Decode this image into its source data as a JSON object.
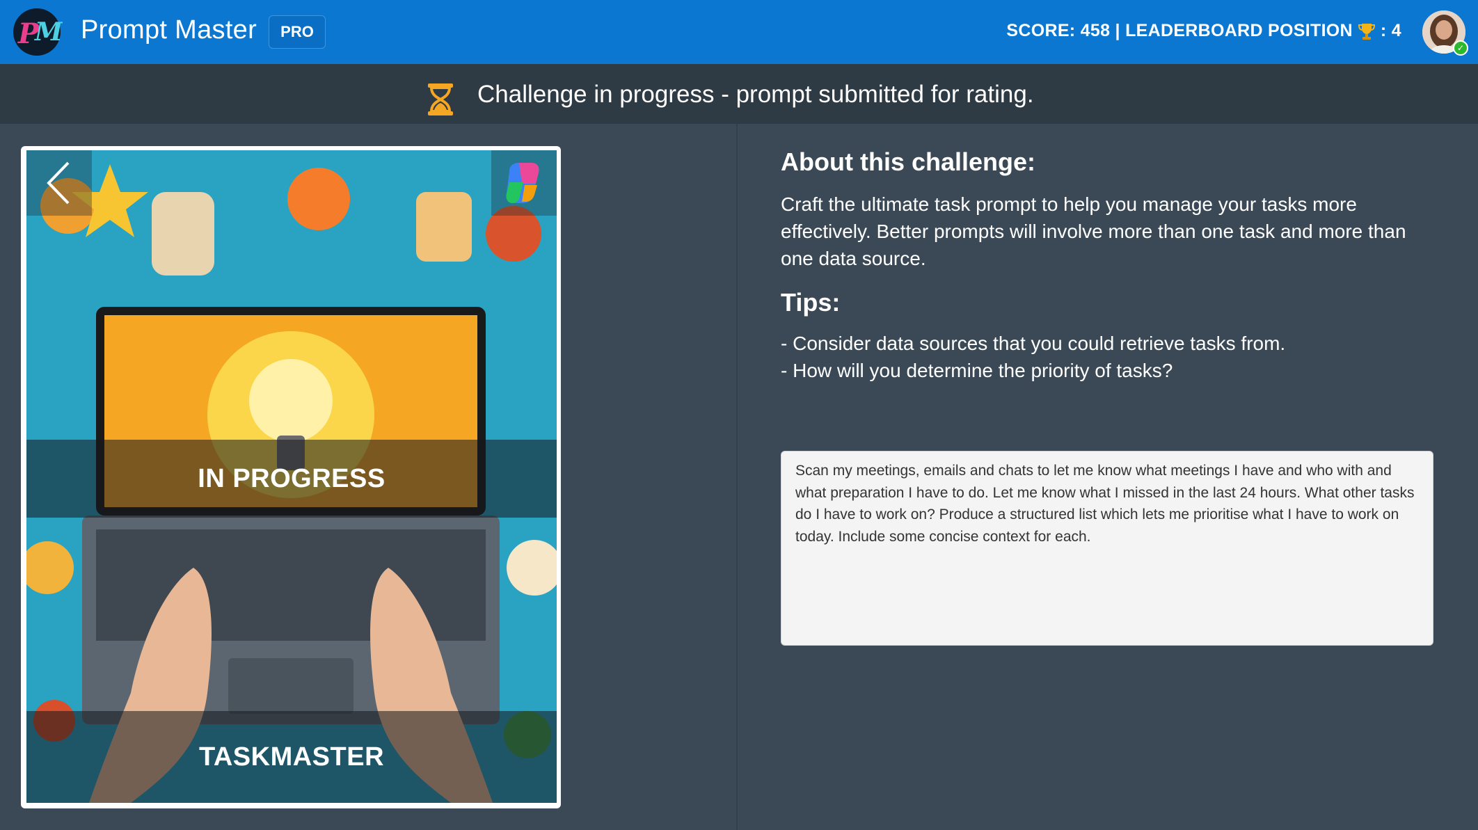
{
  "header": {
    "logo_text": "PM",
    "app_title": "Prompt Master",
    "badge": "PRO",
    "score_label": "SCORE: 458 | LEADERBOARD POSITION",
    "position_value": ": 4",
    "avatar_icon": "user-avatar",
    "trophy_icon": "trophy-icon"
  },
  "status": {
    "icon": "hourglass-icon",
    "text": "Challenge in progress - prompt submitted for rating."
  },
  "card": {
    "status_banner": "IN PROGRESS",
    "name_banner": "TASKMASTER",
    "prev_icon": "chevron-left-icon",
    "copilot_icon": "copilot-icon"
  },
  "about": {
    "heading": "About this challenge:",
    "body": "Craft the ultimate task prompt to help you manage your tasks more effectively. Better prompts will involve more than one task and more than one data source."
  },
  "tips": {
    "heading": "Tips:",
    "items": [
      "- Consider data sources that you could retrieve tasks from.",
      "- How will you determine the priority of tasks?"
    ]
  },
  "prompt": {
    "value": "Scan my meetings, emails and chats to let me know what meetings I have and who with and what preparation I have to do. Let me know what I missed in the last 24 hours. What other tasks do I have to work on? Produce a structured list which lets me prioritise what I have to work on today. Include some concise context for each."
  },
  "colors": {
    "header_bg": "#0b77d1",
    "status_bg": "#2e3a44",
    "main_bg": "#3a4955",
    "accent_orange": "#f5a623"
  }
}
